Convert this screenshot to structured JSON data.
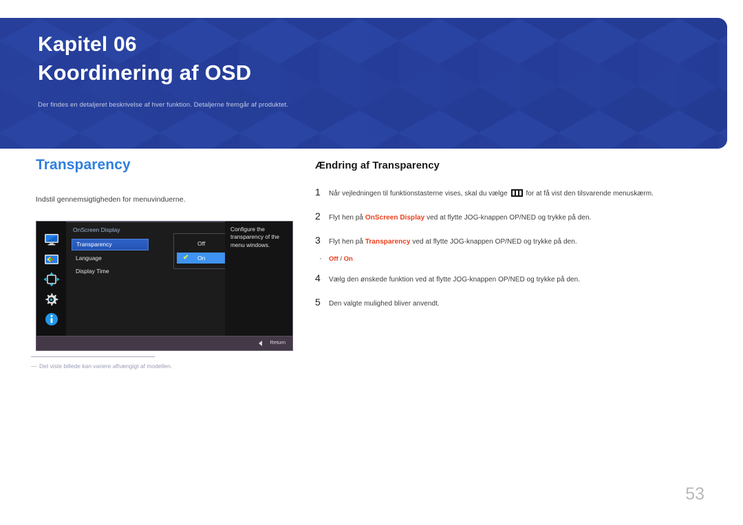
{
  "banner": {
    "chapter_label": "Kapitel 06",
    "chapter_title": "Koordinering af OSD",
    "subtitle": "Der findes en detaljeret beskrivelse af hver funktion. Detaljerne fremgår af produktet.",
    "background_color": "#27409a",
    "accent_color": "#2f7fe0"
  },
  "left": {
    "section_title": "Transparency",
    "description": "Indstil gennemsigtigheden for menuvinduerne.",
    "footnote": "Det viste billede kan variere afhængigt af modellen.",
    "footnote_dash": "―"
  },
  "osd": {
    "menu_heading": "OnScreen Display",
    "icons": [
      "monitor-icon",
      "picture-color-icon",
      "position-arrows-icon",
      "gear-icon",
      "info-icon"
    ],
    "menu_items": [
      {
        "label": "Transparency",
        "selected": true
      },
      {
        "label": "Language",
        "selected": false
      },
      {
        "label": "Display Time",
        "selected": false
      }
    ],
    "submenu": [
      {
        "label": "Off",
        "selected": false,
        "checked": false
      },
      {
        "label": "On",
        "selected": true,
        "checked": true
      }
    ],
    "check_glyph": "✔",
    "help_text": "Configure the transparency of the menu windows.",
    "return_label": "Return",
    "highlight_color": "#2f63c8",
    "submenu_highlight_color": "#3f93f2",
    "check_color": "#d8f048"
  },
  "right": {
    "procedure_title": "Ændring af Transparency",
    "steps": [
      {
        "number": "1",
        "pre": "Når vejledningen til funktionstasterne vises, skal du vælge",
        "has_icon": true,
        "post": "for at få vist den tilsvarende menuskærm."
      },
      {
        "number": "2",
        "pre": "Flyt hen på",
        "highlight": "OnScreen Display",
        "post": "ved at flytte JOG-knappen OP/NED og trykke på den."
      },
      {
        "number": "3",
        "pre": "Flyt hen på",
        "highlight": "Transparency",
        "post": "ved at flytte JOG-knappen OP/NED og trykke på den."
      }
    ],
    "bullet": {
      "dot": "·",
      "option_a": "Off",
      "separator": " / ",
      "option_b": "On"
    },
    "steps_after": [
      {
        "number": "4",
        "text": "Vælg den ønskede funktion ved at flytte JOG-knappen OP/NED og trykke på den."
      },
      {
        "number": "5",
        "text": "Den valgte mulighed bliver anvendt."
      }
    ],
    "highlight_color": "#e8411c"
  },
  "page_number": "53"
}
